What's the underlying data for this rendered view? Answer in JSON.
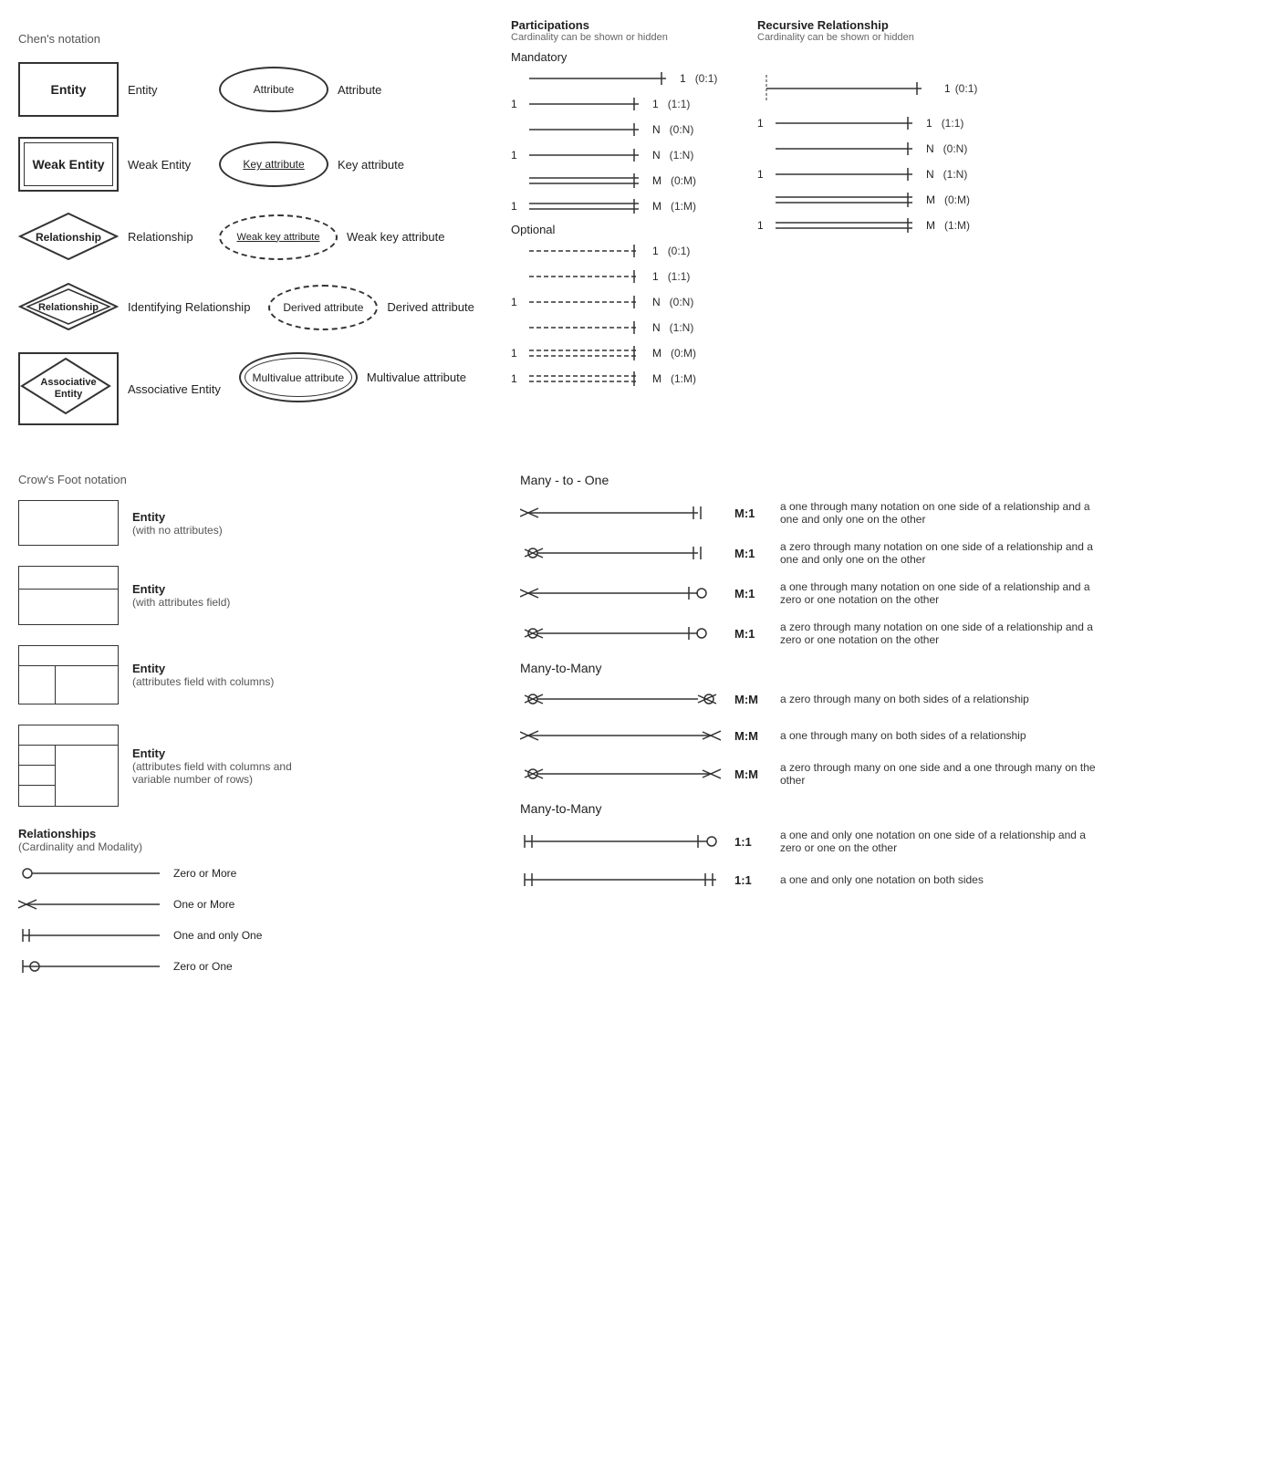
{
  "chens": {
    "title": "Chen's notation",
    "rows": [
      {
        "symbol_label": "Entity",
        "shape": "entity",
        "attr_label": "Attribute",
        "attr_shape": "ellipse"
      },
      {
        "symbol_label": "Weak Entity",
        "shape": "weak_entity",
        "attr_label": "Key attribute",
        "attr_shape": "ellipse_underline"
      },
      {
        "symbol_label": "Relationship",
        "shape": "diamond",
        "attr_label": "Weak key attribute",
        "attr_shape": "ellipse_dashed_underline"
      },
      {
        "symbol_label": "Identifying Relationship",
        "shape": "diamond_double",
        "attr_label": "Derived attribute",
        "attr_shape": "ellipse_dashed"
      },
      {
        "symbol_label": "Associative Entity",
        "shape": "assoc_entity",
        "attr_label": "Multivalue attribute",
        "attr_shape": "ellipse_double"
      }
    ]
  },
  "participations": {
    "title": "Participations",
    "subtitle": "Cardinality can be shown or hidden",
    "mandatory_title": "Mandatory",
    "mandatory_rows": [
      {
        "left": "",
        "right": "1",
        "notation": "(0:1)"
      },
      {
        "left": "1",
        "right": "1",
        "notation": "(1:1)"
      },
      {
        "left": "",
        "right": "N",
        "notation": "(0:N)"
      },
      {
        "left": "1",
        "right": "N",
        "notation": "(1:N)"
      },
      {
        "left": "",
        "right": "M",
        "notation": "(0:M)"
      },
      {
        "left": "1",
        "right": "M",
        "notation": "(1:M)"
      }
    ],
    "optional_title": "Optional",
    "optional_rows": [
      {
        "left": "",
        "right": "1",
        "notation": "(0:1)"
      },
      {
        "left": "",
        "right": "1",
        "notation": "(1:1)"
      },
      {
        "left": "1",
        "right": "N",
        "notation": "(0:N)"
      },
      {
        "left": "",
        "right": "N",
        "notation": "(1:N)"
      },
      {
        "left": "1",
        "right": "M",
        "notation": "(0:M)"
      },
      {
        "left": "1",
        "right": "M",
        "notation": "(1:M)"
      }
    ]
  },
  "recursive": {
    "title": "Recursive Relationship",
    "subtitle": "Cardinality can be shown or hidden",
    "rows": [
      {
        "left": "",
        "right": "1",
        "notation": "(0:1)"
      },
      {
        "left": "1",
        "right": "1",
        "notation": "(1:1)"
      },
      {
        "left": "",
        "right": "N",
        "notation": "(0:N)"
      },
      {
        "left": "1",
        "right": "N",
        "notation": "(1:N)"
      },
      {
        "left": "",
        "right": "M",
        "notation": "(0:M)"
      },
      {
        "left": "1",
        "right": "M",
        "notation": "(1:M)"
      }
    ]
  },
  "crows": {
    "title": "Crow's Foot notation",
    "entities": [
      {
        "label": "Entity",
        "sublabel": "(with no attributes)",
        "shape": "simple"
      },
      {
        "label": "Entity",
        "sublabel": "(with attributes field)",
        "shape": "attrs"
      },
      {
        "label": "Entity",
        "sublabel": "(attributes field with columns)",
        "shape": "cols"
      },
      {
        "label": "Entity",
        "sublabel": "(attributes field with columns and variable number of rows)",
        "shape": "varrows"
      }
    ],
    "many_to_one_title": "Many - to - One",
    "many_to_one_rows": [
      {
        "label": "M:1",
        "desc": "a one through many notation on one side of a relationship and a one and only one on the other"
      },
      {
        "label": "M:1",
        "desc": "a zero through many notation on one side of a relationship and a one and only one on the other"
      },
      {
        "label": "M:1",
        "desc": "a one through many notation on one side of a relationship and a zero or one notation on the other"
      },
      {
        "label": "M:1",
        "desc": "a zero through many notation on one side of a relationship and a zero or one notation on the other"
      }
    ],
    "many_to_many_title": "Many-to-Many",
    "many_to_many_rows": [
      {
        "label": "M:M",
        "desc": "a zero through many on both sides of a relationship"
      },
      {
        "label": "M:M",
        "desc": "a one through many on both sides of a relationship"
      },
      {
        "label": "M:M",
        "desc": "a zero through many on one side and a one through many on the other"
      }
    ],
    "one_to_one_title": "Many-to-Many",
    "one_to_one_rows": [
      {
        "label": "1:1",
        "desc": "a one and only one notation on one side of a relationship and a zero or one on the other"
      },
      {
        "label": "1:1",
        "desc": "a one and only one notation on both sides"
      }
    ],
    "relationships_title": "Relationships",
    "relationships_subtitle": "(Cardinality and Modality)",
    "legend_rows": [
      {
        "label": "Zero or More"
      },
      {
        "label": "One or More"
      },
      {
        "label": "One and only One"
      },
      {
        "label": "Zero or One"
      }
    ]
  }
}
